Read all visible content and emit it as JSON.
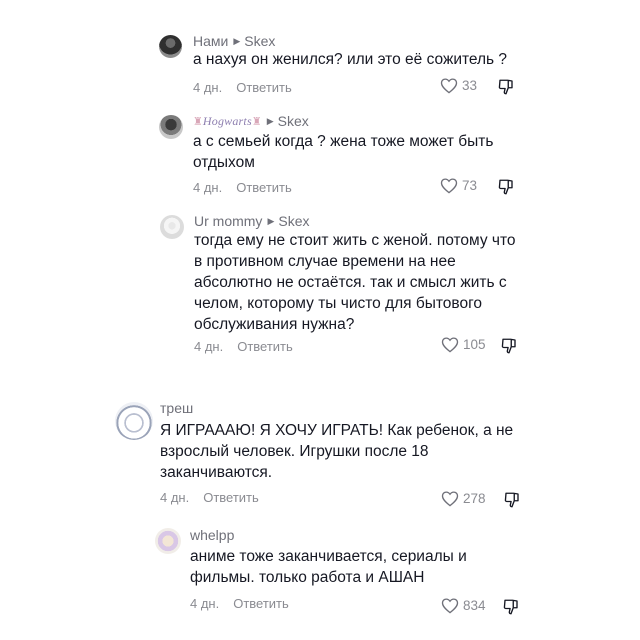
{
  "comments": [
    {
      "author": "Нами",
      "reply_to": "Skex",
      "text": "а нахуя он женился? или это её сожитель ?",
      "age": "4 дн.",
      "reply_label": "Ответить",
      "likes": "33"
    },
    {
      "author": "Hogwarts",
      "author_deco": "🏰",
      "reply_to": "Skex",
      "text": "а с семьей когда ? жена тоже может быть отдыхом",
      "age": "4 дн.",
      "reply_label": "Ответить",
      "likes": "73"
    },
    {
      "author": "Ur mommy",
      "reply_to": "Skex",
      "text": "тогда ему не стоит жить с женой. потому что в противном случае времени на нее абсолютно не остаётся. так и смысл жить с челом, которому ты чисто для бытового обслуживания нужна?",
      "age": "4 дн.",
      "reply_label": "Ответить",
      "likes": "105"
    },
    {
      "author": "треш",
      "text": "Я ИГРАААЮ! Я ХОЧУ ИГРАТЬ! Как ребенок, а не взрослый человек. Игрушки после 18 заканчиваются.",
      "age": "4 дн.",
      "reply_label": "Ответить",
      "likes": "278"
    },
    {
      "author": "whelpp",
      "text": "аниме тоже заканчивается, сериалы и фильмы. только работа и АШАН",
      "age": "4 дн.",
      "reply_label": "Ответить",
      "likes": "834"
    }
  ],
  "icons": {
    "like": "heart-outline-icon",
    "dislike": "thumb-down-icon",
    "reply_arrow": "triangle-right-icon"
  },
  "colors": {
    "text": "#161823",
    "muted": "#8a8b91"
  }
}
